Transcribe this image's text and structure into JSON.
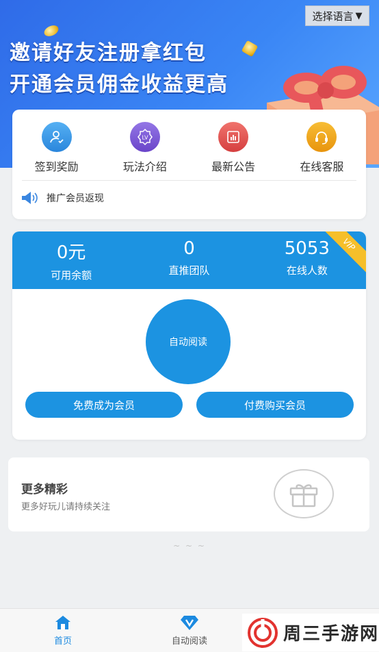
{
  "banner": {
    "line1": "邀请好友注册拿红包",
    "line2": "开通会员佣金收益更高"
  },
  "language_button": {
    "label": "选择语言",
    "arrow": "▼"
  },
  "features": [
    {
      "label": "签到奖励",
      "icon": "user-check-icon",
      "color": "#3a9ae8"
    },
    {
      "label": "玩法介绍",
      "icon": "lv-badge-icon",
      "color": "#7d5bd6"
    },
    {
      "label": "最新公告",
      "icon": "chart-bars-icon",
      "color": "#e2544f"
    },
    {
      "label": "在线客服",
      "icon": "headset-icon",
      "color": "#efa21a"
    }
  ],
  "notice": {
    "text": "推广会员返现",
    "icon": "speaker-icon"
  },
  "stats": [
    {
      "value": "0元",
      "label": "可用余额"
    },
    {
      "value": "0",
      "label": "直推团队"
    },
    {
      "value": "5053",
      "label": "在线人数"
    }
  ],
  "vip_badge": "VIP",
  "auto_read_button": "自动阅读",
  "membership_buttons": {
    "free": "免费成为会员",
    "paid": "付费购买会员"
  },
  "more": {
    "title": "更多精彩",
    "subtitle": "更多好玩儿请持续关注",
    "icon": "gift-icon"
  },
  "dots": "~ ~ ~",
  "tabbar": [
    {
      "label": "首页",
      "icon": "home-icon",
      "active": true
    },
    {
      "label": "自动阅读",
      "icon": "diamond-v-icon",
      "active": false
    }
  ],
  "watermark": {
    "text": "周三手游网",
    "icon": "watermark-logo-icon"
  },
  "colors": {
    "primary": "#1c93e1",
    "banner": "#2f6be8",
    "vip": "#f6bf2a"
  }
}
